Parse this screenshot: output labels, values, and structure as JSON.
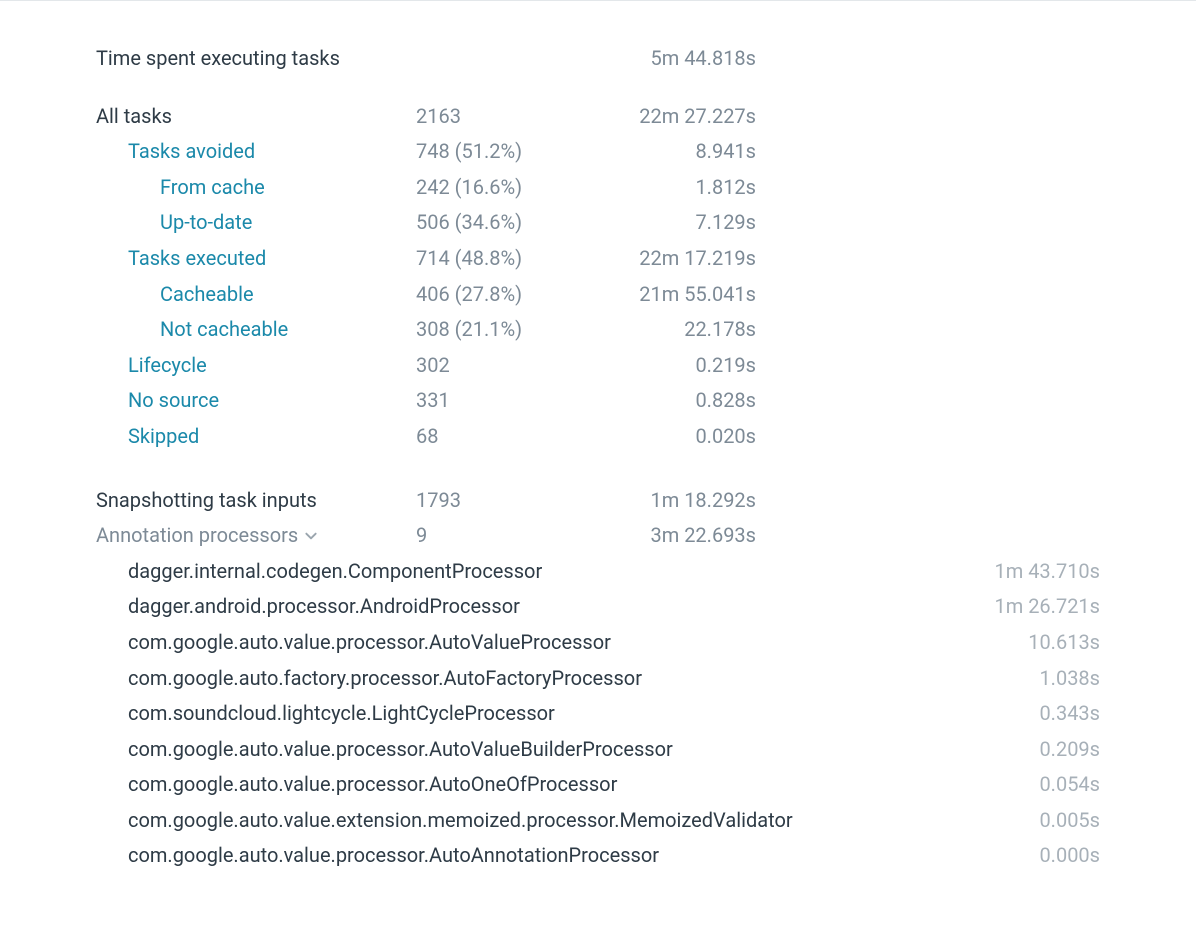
{
  "summary": {
    "header_label": "Time spent executing tasks",
    "header_time": "5m 44.818s",
    "all_tasks_label": "All tasks",
    "all_tasks_count": "2163",
    "all_tasks_time": "22m 27.227s",
    "rows": [
      {
        "label": "Tasks avoided",
        "count": "748 (51.2%)",
        "time": "8.941s",
        "indent": 1
      },
      {
        "label": "From cache",
        "count": "242 (16.6%)",
        "time": "1.812s",
        "indent": 2
      },
      {
        "label": "Up-to-date",
        "count": "506 (34.6%)",
        "time": "7.129s",
        "indent": 2
      },
      {
        "label": "Tasks executed",
        "count": "714 (48.8%)",
        "time": "22m 17.219s",
        "indent": 1
      },
      {
        "label": "Cacheable",
        "count": "406 (27.8%)",
        "time": "21m 55.041s",
        "indent": 2
      },
      {
        "label": "Not cacheable",
        "count": "308 (21.1%)",
        "time": "22.178s",
        "indent": 2
      },
      {
        "label": "Lifecycle",
        "count": "302",
        "time": "0.219s",
        "indent": 1
      },
      {
        "label": "No source",
        "count": "331",
        "time": "0.828s",
        "indent": 1
      },
      {
        "label": "Skipped",
        "count": "68",
        "time": "0.020s",
        "indent": 1
      }
    ],
    "snapshot_label": "Snapshotting task inputs",
    "snapshot_count": "1793",
    "snapshot_time": "1m 18.292s",
    "ap_label": "Annotation processors",
    "ap_count": "9",
    "ap_time": "3m 22.693s"
  },
  "annotation_processors": [
    {
      "name": "dagger.internal.codegen.ComponentProcessor",
      "time": "1m 43.710s"
    },
    {
      "name": "dagger.android.processor.AndroidProcessor",
      "time": "1m 26.721s"
    },
    {
      "name": "com.google.auto.value.processor.AutoValueProcessor",
      "time": "10.613s"
    },
    {
      "name": "com.google.auto.factory.processor.AutoFactoryProcessor",
      "time": "1.038s"
    },
    {
      "name": "com.soundcloud.lightcycle.LightCycleProcessor",
      "time": "0.343s"
    },
    {
      "name": "com.google.auto.value.processor.AutoValueBuilderProcessor",
      "time": "0.209s"
    },
    {
      "name": "com.google.auto.value.processor.AutoOneOfProcessor",
      "time": "0.054s"
    },
    {
      "name": "com.google.auto.value.extension.memoized.processor.MemoizedValidator",
      "time": "0.005s"
    },
    {
      "name": "com.google.auto.value.processor.AutoAnnotationProcessor",
      "time": "0.000s"
    }
  ]
}
